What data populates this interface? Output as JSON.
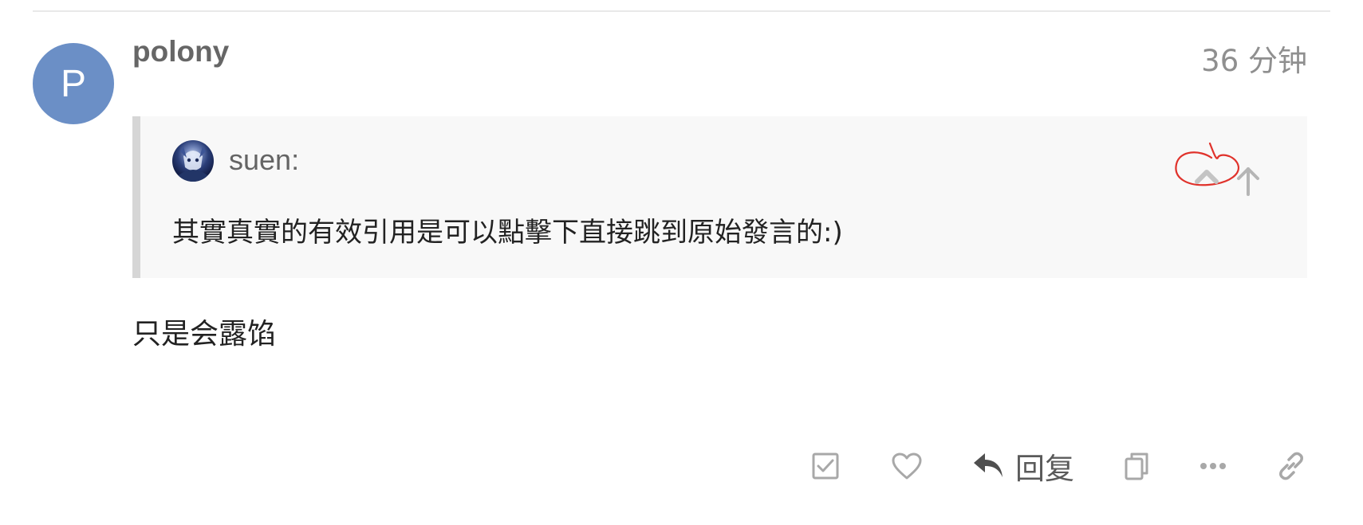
{
  "post": {
    "author": "polony",
    "avatar_letter": "P",
    "avatar_color": "#6b8fc6",
    "time": "36 分钟",
    "quote": {
      "author": "suen:",
      "text": "其實真實的有效引用是可以點擊下直接跳到原始發言的:)"
    },
    "body": "只是会露馅"
  },
  "actions": {
    "reply_label": "回复"
  },
  "icons": {
    "checkbox": "checkbox-icon",
    "like": "heart-icon",
    "reply": "reply-arrow-icon",
    "copy": "copy-icon",
    "more": "more-dots-icon",
    "link": "link-icon",
    "expand": "chevron-up-icon",
    "jump": "arrow-up-icon"
  },
  "colors": {
    "annotation": "#e0322b",
    "icon_gray": "#a0a0a0"
  }
}
